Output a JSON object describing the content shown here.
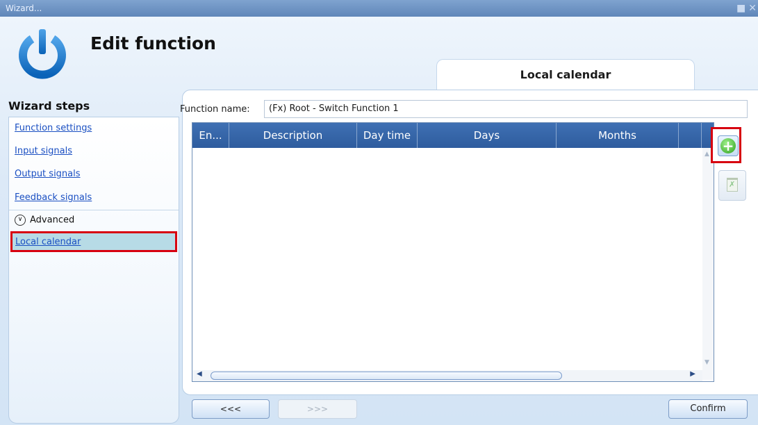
{
  "window": {
    "title": "Wizard...",
    "controls": [
      "restore-icon",
      "close-icon"
    ]
  },
  "header": {
    "title": "Edit function",
    "logo_icon": "power-icon"
  },
  "tab": {
    "label": "Local calendar"
  },
  "sidebar": {
    "heading": "Wizard steps",
    "items": [
      {
        "label": "Function settings"
      },
      {
        "label": "Input signals"
      },
      {
        "label": "Output signals"
      },
      {
        "label": "Feedback signals"
      }
    ],
    "advanced_label": "Advanced",
    "selected_label": "Local calendar"
  },
  "form": {
    "function_name_label": "Function name:",
    "function_name_value": "(Fx) Root - Switch Function 1"
  },
  "grid": {
    "columns": [
      "En...",
      "Description",
      "Day time",
      "Days",
      "Months"
    ],
    "rows": []
  },
  "actions": {
    "add_icon": "add-icon",
    "delete_icon": "delete-icon"
  },
  "footer": {
    "prev_label": "<<<",
    "next_label": ">>>",
    "confirm_label": "Confirm"
  },
  "colors": {
    "accent": "#2e5c9e",
    "highlight_border": "#d7000f",
    "selected_bg": "#b7dbe6",
    "link": "#1a4fc2"
  }
}
